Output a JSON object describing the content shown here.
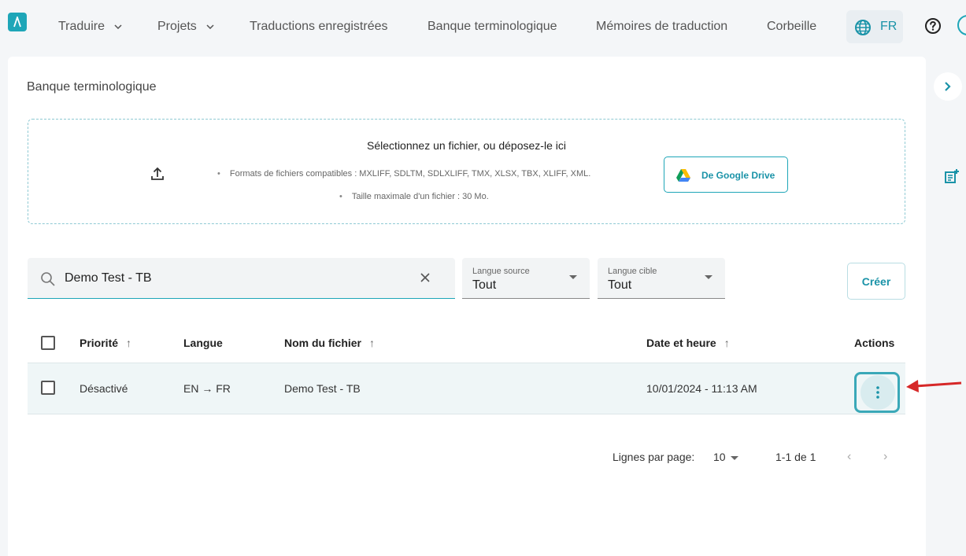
{
  "app": {
    "accent_color": "#1ea6b8",
    "logo_icon": "app-logo-icon"
  },
  "nav": {
    "items": [
      {
        "label": "Traduire",
        "has_dropdown": true
      },
      {
        "label": "Projets",
        "has_dropdown": true
      },
      {
        "label": "Traductions enregistrées",
        "has_dropdown": false
      },
      {
        "label": "Banque terminologique",
        "has_dropdown": false
      },
      {
        "label": "Mémoires de traduction",
        "has_dropdown": false
      },
      {
        "label": "Corbeille",
        "has_dropdown": false
      }
    ],
    "language": "FR",
    "language_icon": "globe-icon",
    "help_icon": "help-icon"
  },
  "page": {
    "title": "Banque terminologique"
  },
  "upload": {
    "title": "Sélectionnez un fichier, ou déposez-le ici",
    "formats": "Formats de fichiers compatibles : MXLIFF, SDLTM, SDLXLIFF, TMX, XLSX, TBX, XLIFF, XML.",
    "max_size": "Taille maximale d'un fichier : 30 Mo.",
    "gdrive_label": "De Google Drive",
    "upload_icon": "upload-icon"
  },
  "filters": {
    "search_value": "Demo Test - TB",
    "source_label": "Langue source",
    "source_value": "Tout",
    "target_label": "Langue cible",
    "target_value": "Tout",
    "create_label": "Créer"
  },
  "table": {
    "headers": {
      "priority": "Priorité",
      "language": "Langue",
      "filename": "Nom du fichier",
      "datetime": "Date et heure",
      "actions": "Actions"
    },
    "rows": [
      {
        "priority": "Désactivé",
        "language": "EN → FR",
        "filename": "Demo Test - TB",
        "datetime": "10/01/2024 - 11:13 AM"
      }
    ]
  },
  "pagination": {
    "rows_per_page_label": "Lignes par page:",
    "rows_per_page_value": "10",
    "range": "1-1 de 1"
  },
  "annotation": {
    "arrow_color": "#d62828",
    "highlight_color": "#3aa8b8"
  }
}
